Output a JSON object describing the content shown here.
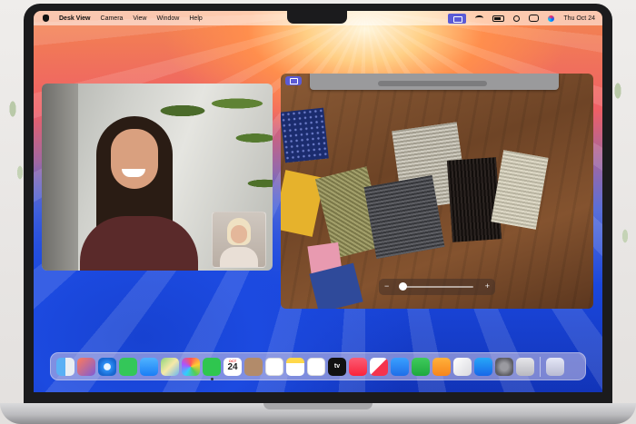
{
  "menubar": {
    "app_name": "Desk View",
    "menus": [
      "Camera",
      "View",
      "Window",
      "Help"
    ],
    "clock": "Thu Oct 24"
  },
  "dock": {
    "calendar": {
      "month": "OCT",
      "day": "24"
    },
    "apple_tv_label": "tv",
    "items": [
      "finder-icon",
      "launchpad-icon",
      "safari-icon",
      "messages-icon",
      "mail-icon",
      "maps-icon",
      "photos-icon",
      "facetime-icon",
      "calendar-icon",
      "contacts-icon",
      "reminders-icon",
      "notes-icon",
      "freeform-icon",
      "apple-tv-icon",
      "music-icon",
      "news-icon",
      "keynote-icon",
      "numbers-icon",
      "pages-icon",
      "iphone-mirroring-icon",
      "app-store-icon",
      "system-settings-icon",
      "preview-icon",
      "trash-icon"
    ]
  },
  "desk_view": {
    "zoom_minus": "−",
    "zoom_plus": "+",
    "zoom_level": 0.05
  },
  "colors": {
    "accent": "#5b5bd6"
  }
}
